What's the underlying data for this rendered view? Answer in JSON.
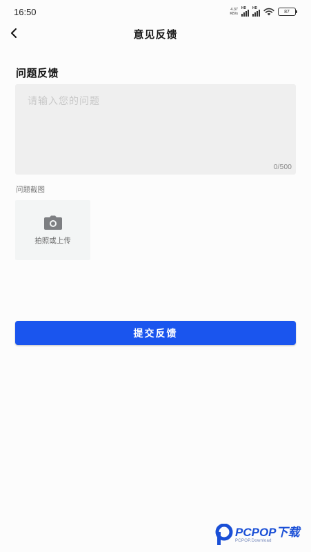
{
  "status_bar": {
    "time": "16:50",
    "net_speed_value": "4.37",
    "net_speed_unit": "KB/s",
    "sim1_label": "HD",
    "sim2_label": "HD",
    "battery": "87"
  },
  "nav": {
    "title": "意见反馈"
  },
  "feedback": {
    "section_title": "问题反馈",
    "placeholder": "请输入您的问题",
    "value": "",
    "char_count": "0/500"
  },
  "screenshot": {
    "label": "问题截图",
    "upload_text": "拍照或上传"
  },
  "submit": {
    "label": "提交反馈"
  },
  "watermark": {
    "main": "PCPOP下载",
    "sub": "PCPOP.Download"
  },
  "colors": {
    "primary": "#1a55ee",
    "background": "#fcfcfc",
    "input_bg": "#efefef",
    "upload_bg": "#f3f5f5"
  }
}
